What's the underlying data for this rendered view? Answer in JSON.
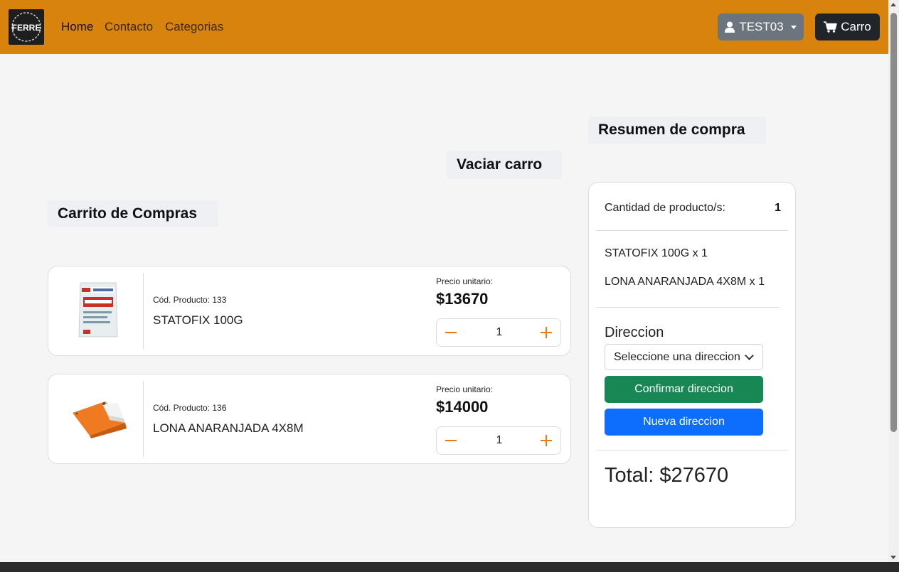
{
  "nav": {
    "links": [
      "Home",
      "Contacto",
      "Categorias"
    ],
    "user_label": "TEST03",
    "cart_label": "Carro",
    "logo_text": "FERRE"
  },
  "headings": {
    "summary_title": "Resumen de compra",
    "empty_cart": "Vaciar carro",
    "cart_title": "Carrito de Compras"
  },
  "products": [
    {
      "code_label": "Cód. Producto: 133",
      "name": "STATOFIX 100G",
      "unit_label": "Precio unitario:",
      "price": "$13670",
      "qty": "1",
      "image": "statofix-bag-image"
    },
    {
      "code_label": "Cód. Producto: 136",
      "name": "LONA ANARANJADA 4X8M",
      "unit_label": "Precio unitario:",
      "price": "$14000",
      "qty": "1",
      "image": "orange-tarp-image"
    }
  ],
  "summary": {
    "qty_label": "Cantidad de producto/s:",
    "qty_value": "1",
    "items": [
      "STATOFIX 100G x 1",
      "LONA ANARANJADA 4X8M x 1"
    ],
    "direction_label": "Direccion",
    "select_placeholder": "Seleccione una direccion",
    "confirm_label": "Confirmar direccion",
    "new_label": "Nueva direccion",
    "total_label": "Total: $27670"
  },
  "colors": {
    "navbar": "#d9830f",
    "accent_orange": "#e37b1c",
    "confirm_green": "#198754",
    "new_blue": "#0d6efd",
    "user_gray": "#6c757d",
    "cart_dark": "#212529"
  }
}
